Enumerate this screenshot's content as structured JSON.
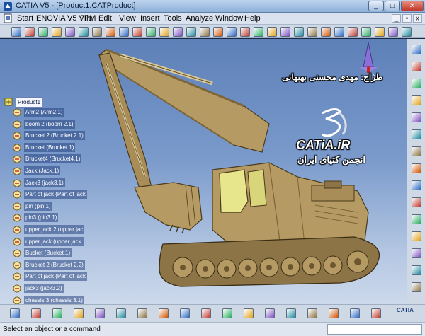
{
  "window": {
    "title": "CATIA V5 - [Product1.CATProduct]",
    "minimize": "_",
    "maximize": "□",
    "close": "✕"
  },
  "menu": {
    "items": [
      "Start",
      "ENOVIA V5 VPM",
      "File",
      "Edit",
      "View",
      "Insert",
      "Tools",
      "Analyze",
      "Window",
      "Help"
    ],
    "mdi_minimize": "_",
    "mdi_restore": "▫",
    "mdi_close": "x"
  },
  "tree": {
    "root": "Product1",
    "nodes": [
      "Arm2 (Arm2.1)",
      "boom 2 (boom 2.1)",
      "Brucket 2 (Brucket 2.1)",
      "Brucket (Brucket.1)",
      "Brucket4 (Brucket4.1)",
      "Jack (Jack.1)",
      "Jack3 (jack3.1)",
      "Part of jack (Part of jack",
      "pin (pin.1)",
      "pin3 (pin3.1)",
      "upper jack 2 (upper jac",
      "upper jack (upper jack.",
      "Bucket (Bucket.1)",
      "Brucket 2 (Brucket 2.2)",
      "Part of jack (Part of jack",
      "jack3 (jack3.2)",
      "chassis 3 (chassis 3.1)"
    ]
  },
  "watermark": {
    "designer": "طراح: مهدی محسنی بهبهانی",
    "site": "CATiA.iR",
    "community": "انجمن کتیای ایران"
  },
  "status": {
    "message": "Select an object or a command",
    "command_value": ""
  },
  "branding": {
    "logo_text": "CATIA"
  },
  "colors": {
    "body": "#b59a63",
    "body_dark": "#7d6538",
    "track": "#8c7446",
    "cabin_glass": "#e8e68c",
    "tree_label_bg": "#2d4f8c"
  },
  "toolbars": {
    "top_icons": [
      "product-icon",
      "sketch-icon",
      "move-icon",
      "pan-icon",
      "zoom-in-icon",
      "zoom-out-icon",
      "normal-view-icon",
      "iso-view-icon",
      "multi-view-icon",
      "shading-icon",
      "hide-show-icon",
      "swap-icon",
      "constraint-icon",
      "fix-icon",
      "coincidence-icon",
      "contact-icon",
      "offset-icon",
      "angle-icon",
      "fix-together-icon",
      "quick-constraint-icon",
      "manipulation-icon",
      "snap-icon",
      "explode-icon",
      "clash-icon",
      "update-icon",
      "section-icon",
      "distance-icon",
      "measure-icon",
      "knowledge-icon",
      "book-icon"
    ],
    "right_icons": [
      "axis-icon",
      "compass-icon",
      "assembly-icon",
      "existing-component-icon",
      "new-part-icon",
      "new-product-icon",
      "replace-icon",
      "graph-tree-icon",
      "reorder-icon",
      "numbering-icon",
      "catalog-icon",
      "bill-of-material-icon",
      "scene-icon",
      "annotation-icon",
      "save-icon"
    ],
    "bottom_icons": [
      "undo-icon",
      "redo-icon",
      "fly-icon",
      "rotate-icon",
      "pan-view-icon",
      "zoom-view-icon",
      "fit-all-icon",
      "iso-icon",
      "layer-icon",
      "properties-icon",
      "catalog-browser-icon",
      "formula-icon",
      "materials-icon",
      "hide-icon",
      "swap-visible-icon",
      "render-icon",
      "light-icon",
      "camera-icon"
    ]
  }
}
